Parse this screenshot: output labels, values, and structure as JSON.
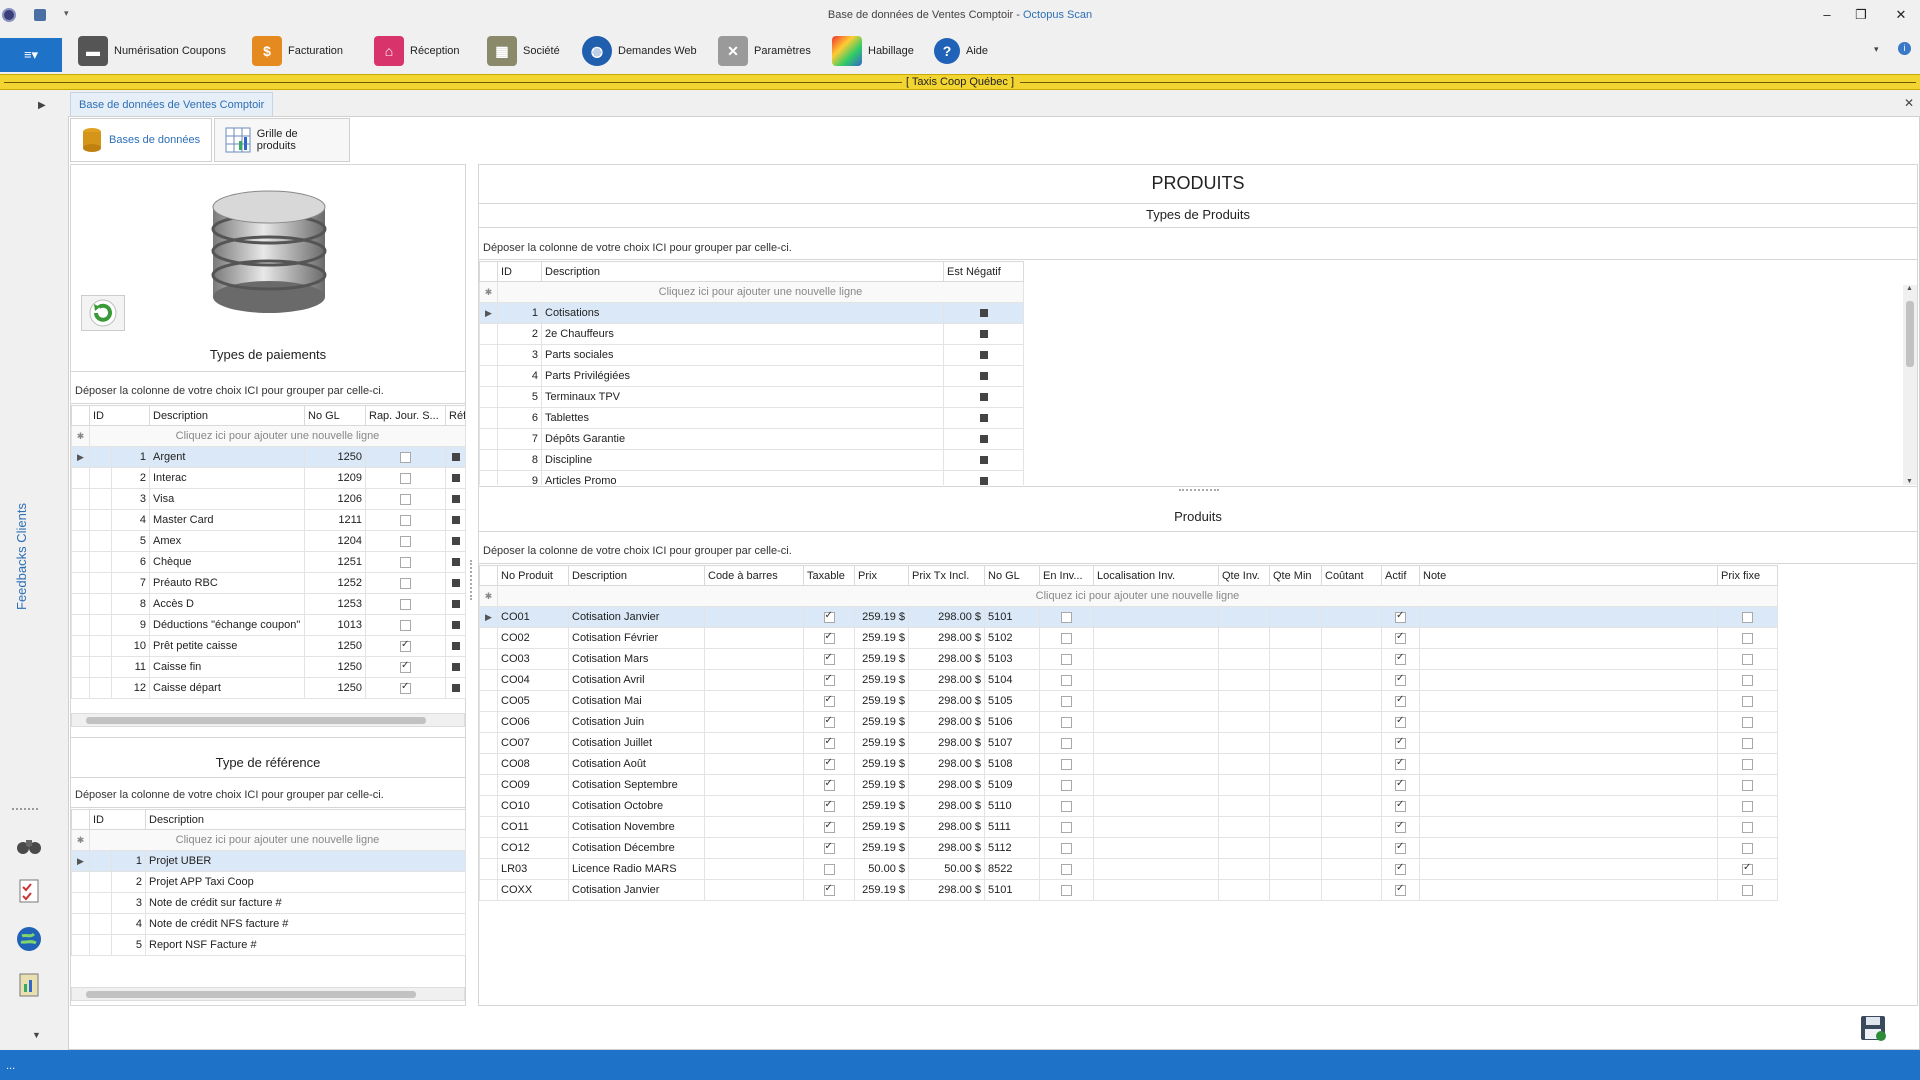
{
  "window": {
    "title_prefix": "Base de données de Ventes Comptoir - ",
    "title_brand": "Octopus Scan",
    "btn_min": "–",
    "btn_max": "❐",
    "btn_close": "✕"
  },
  "ribbon": {
    "app_menu_icon": "≡▾",
    "items": [
      {
        "label": "Numérisation Coupons",
        "icon": "scanner-icon"
      },
      {
        "label": "Facturation",
        "icon": "invoice-icon"
      },
      {
        "label": "Réception",
        "icon": "home-icon"
      },
      {
        "label": "Société",
        "icon": "building-icon"
      },
      {
        "label": "Demandes Web",
        "icon": "globe-icon"
      },
      {
        "label": "Paramètres",
        "icon": "tools-icon"
      },
      {
        "label": "Habillage",
        "icon": "palette-icon"
      },
      {
        "label": "Aide",
        "icon": "help-icon"
      }
    ]
  },
  "company_bar": {
    "label": "[   Taxis Coop Québec   ]"
  },
  "side_strip": {
    "vertical_label": "Feedbacks Clients"
  },
  "doc_tab": {
    "label": "Base de données de Ventes Comptoir",
    "close": "✕"
  },
  "sub_tabs": [
    {
      "label": "Bases de données"
    },
    {
      "label": "Grille de produits"
    }
  ],
  "group_hint": "Déposer la colonne de votre choix ICI pour grouper par celle-ci.",
  "new_row_hint": "Cliquez ici pour ajouter une nouvelle ligne",
  "payments": {
    "title": "Types de paiements",
    "headers": {
      "id": "ID",
      "desc": "Description",
      "gl": "No GL",
      "rap": "Rap. Jour. S...",
      "ref": "Réf. Ob"
    },
    "rows": [
      {
        "id": "1",
        "desc": "Argent",
        "gl": "1250",
        "rap": false
      },
      {
        "id": "2",
        "desc": "Interac",
        "gl": "1209",
        "rap": false
      },
      {
        "id": "3",
        "desc": "Visa",
        "gl": "1206",
        "rap": false
      },
      {
        "id": "4",
        "desc": "Master Card",
        "gl": "1211",
        "rap": false
      },
      {
        "id": "5",
        "desc": "Amex",
        "gl": "1204",
        "rap": false
      },
      {
        "id": "6",
        "desc": "Chèque",
        "gl": "1251",
        "rap": false
      },
      {
        "id": "7",
        "desc": "Préauto RBC",
        "gl": "1252",
        "rap": false
      },
      {
        "id": "8",
        "desc": "Accès D",
        "gl": "1253",
        "rap": false
      },
      {
        "id": "9",
        "desc": "Déductions \"échange coupon\"",
        "gl": "1013",
        "rap": false
      },
      {
        "id": "10",
        "desc": "Prêt petite caisse",
        "gl": "1250",
        "rap": true
      },
      {
        "id": "11",
        "desc": "Caisse fin",
        "gl": "1250",
        "rap": true
      },
      {
        "id": "12",
        "desc": "Caisse départ",
        "gl": "1250",
        "rap": true
      }
    ]
  },
  "references": {
    "title": "Type de référence",
    "headers": {
      "id": "ID",
      "desc": "Description"
    },
    "rows": [
      {
        "id": "1",
        "desc": "Projet UBER"
      },
      {
        "id": "2",
        "desc": "Projet APP Taxi Coop"
      },
      {
        "id": "3",
        "desc": "Note de crédit sur facture #"
      },
      {
        "id": "4",
        "desc": "Note de crédit NFS facture #"
      },
      {
        "id": "5",
        "desc": "Report NSF Facture #"
      }
    ]
  },
  "produits": {
    "title": "PRODUITS",
    "types_title": "Types de Produits",
    "types_headers": {
      "id": "ID",
      "desc": "Description",
      "neg": "Est Négatif"
    },
    "types_rows": [
      {
        "id": "1",
        "desc": "Cotisations"
      },
      {
        "id": "2",
        "desc": "2e Chauffeurs"
      },
      {
        "id": "3",
        "desc": "Parts sociales"
      },
      {
        "id": "4",
        "desc": "Parts Privilégiées"
      },
      {
        "id": "5",
        "desc": "Terminaux TPV"
      },
      {
        "id": "6",
        "desc": "Tablettes"
      },
      {
        "id": "7",
        "desc": "Dépôts Garantie"
      },
      {
        "id": "8",
        "desc": "Discipline"
      },
      {
        "id": "9",
        "desc": "Articles Promo"
      }
    ],
    "products_title": "Produits",
    "products_headers": {
      "no": "No Produit",
      "desc": "Description",
      "code": "Code à barres",
      "tax": "Taxable",
      "prix": "Prix",
      "prixtx": "Prix Tx Incl.",
      "gl": "No GL",
      "eninv": "En Inv...",
      "loc": "Localisation Inv.",
      "qteinv": "Qte Inv.",
      "qtemin": "Qte Min",
      "cout": "Coûtant",
      "actif": "Actif",
      "note": "Note",
      "fixe": "Prix fixe"
    },
    "rows": [
      {
        "no": "CO01",
        "desc": "Cotisation Janvier",
        "tax": true,
        "prix": "259.19 $",
        "prixtx": "298.00 $",
        "gl": "5101",
        "actif": true,
        "fixe": false
      },
      {
        "no": "CO02",
        "desc": "Cotisation Février",
        "tax": true,
        "prix": "259.19 $",
        "prixtx": "298.00 $",
        "gl": "5102",
        "actif": true,
        "fixe": false
      },
      {
        "no": "CO03",
        "desc": "Cotisation Mars",
        "tax": true,
        "prix": "259.19 $",
        "prixtx": "298.00 $",
        "gl": "5103",
        "actif": true,
        "fixe": false
      },
      {
        "no": "CO04",
        "desc": "Cotisation Avril",
        "tax": true,
        "prix": "259.19 $",
        "prixtx": "298.00 $",
        "gl": "5104",
        "actif": true,
        "fixe": false
      },
      {
        "no": "CO05",
        "desc": "Cotisation Mai",
        "tax": true,
        "prix": "259.19 $",
        "prixtx": "298.00 $",
        "gl": "5105",
        "actif": true,
        "fixe": false
      },
      {
        "no": "CO06",
        "desc": "Cotisation Juin",
        "tax": true,
        "prix": "259.19 $",
        "prixtx": "298.00 $",
        "gl": "5106",
        "actif": true,
        "fixe": false
      },
      {
        "no": "CO07",
        "desc": "Cotisation Juillet",
        "tax": true,
        "prix": "259.19 $",
        "prixtx": "298.00 $",
        "gl": "5107",
        "actif": true,
        "fixe": false
      },
      {
        "no": "CO08",
        "desc": "Cotisation Août",
        "tax": true,
        "prix": "259.19 $",
        "prixtx": "298.00 $",
        "gl": "5108",
        "actif": true,
        "fixe": false
      },
      {
        "no": "CO09",
        "desc": "Cotisation Septembre",
        "tax": true,
        "prix": "259.19 $",
        "prixtx": "298.00 $",
        "gl": "5109",
        "actif": true,
        "fixe": false
      },
      {
        "no": "CO10",
        "desc": "Cotisation Octobre",
        "tax": true,
        "prix": "259.19 $",
        "prixtx": "298.00 $",
        "gl": "5110",
        "actif": true,
        "fixe": false
      },
      {
        "no": "CO11",
        "desc": "Cotisation Novembre",
        "tax": true,
        "prix": "259.19 $",
        "prixtx": "298.00 $",
        "gl": "5111",
        "actif": true,
        "fixe": false
      },
      {
        "no": "CO12",
        "desc": "Cotisation Décembre",
        "tax": true,
        "prix": "259.19 $",
        "prixtx": "298.00 $",
        "gl": "5112",
        "actif": true,
        "fixe": false
      },
      {
        "no": "LR03",
        "desc": "Licence Radio MARS",
        "tax": false,
        "prix": "50.00 $",
        "prixtx": "50.00 $",
        "gl": "8522",
        "actif": true,
        "fixe": true
      },
      {
        "no": "COXX",
        "desc": "Cotisation Janvier",
        "tax": true,
        "prix": "259.19 $",
        "prixtx": "298.00 $",
        "gl": "5101",
        "actif": true,
        "fixe": false
      }
    ]
  },
  "statusbar": {
    "text": "..."
  },
  "colors": {
    "accent": "#1e72c7",
    "company_bar": "#f3d532",
    "selection": "#dbe8f7"
  }
}
